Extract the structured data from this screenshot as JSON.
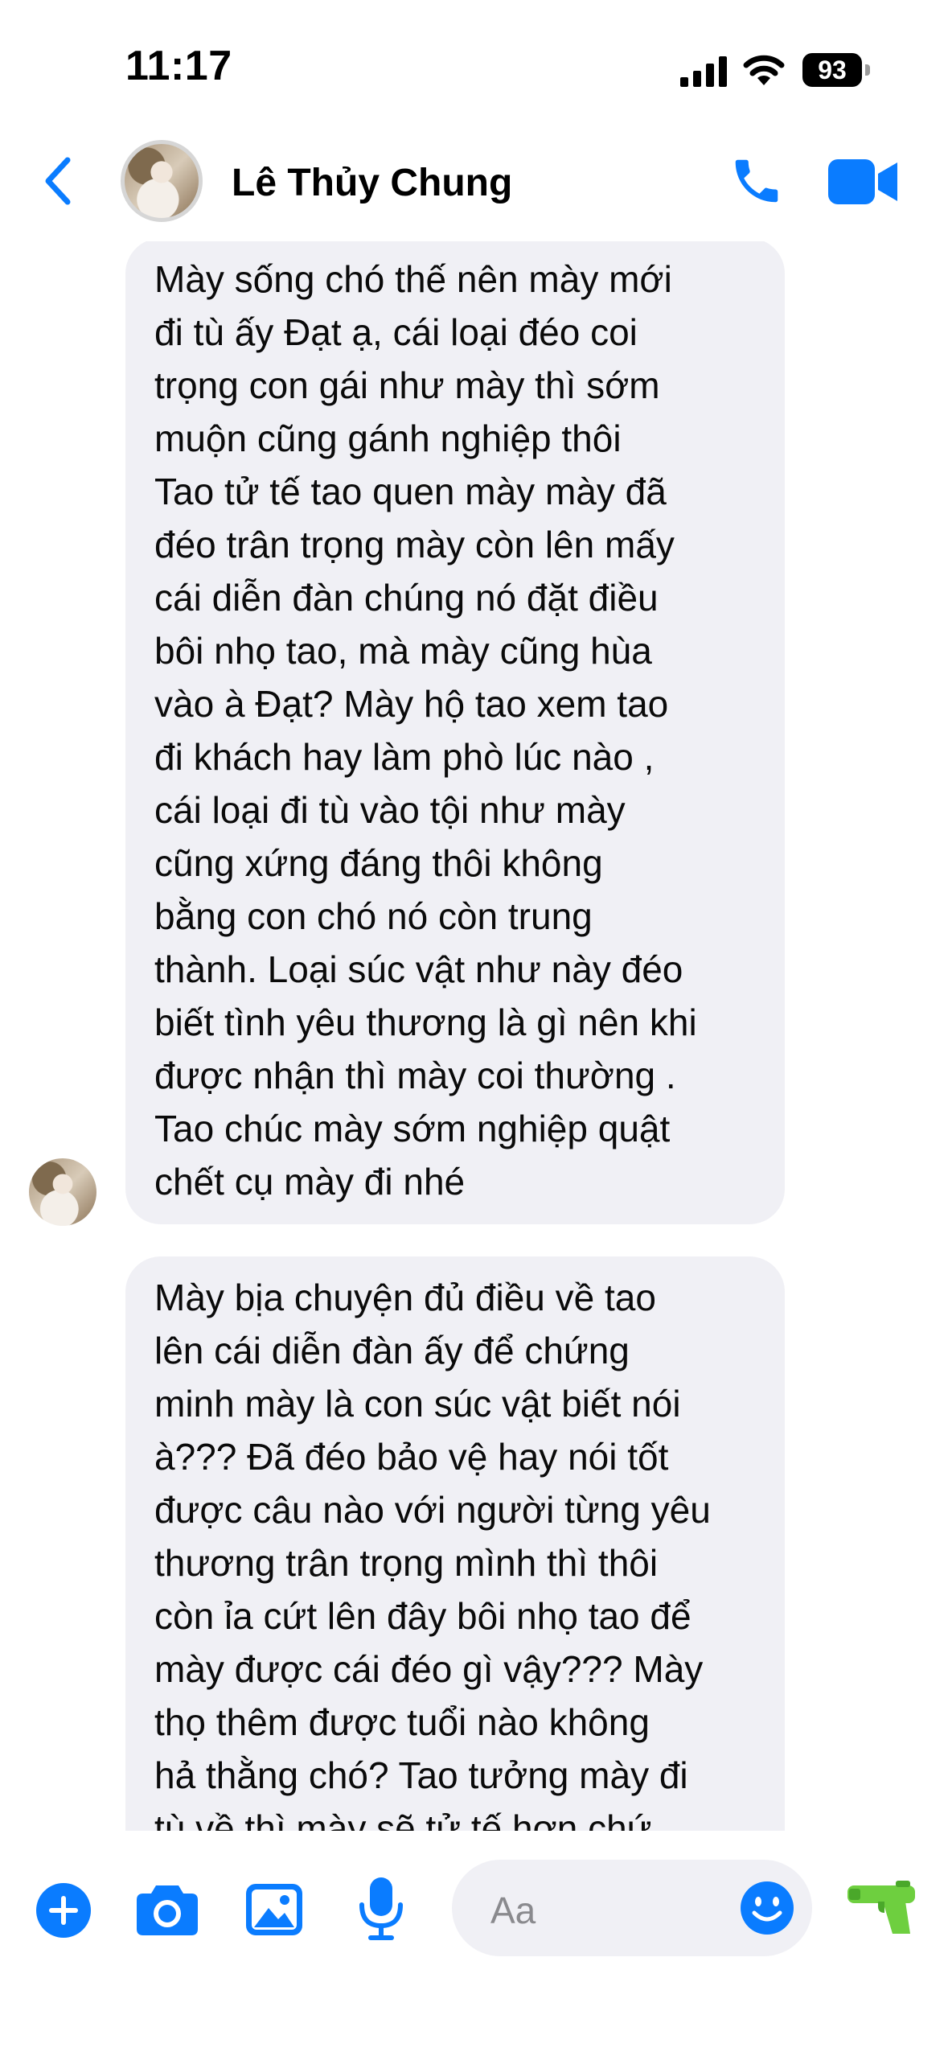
{
  "status_bar": {
    "time": "11:17",
    "battery": "93"
  },
  "header": {
    "contact_name": "Lê Thủy Chung"
  },
  "messages": [
    {
      "sender": "Lê Thủy Chung",
      "text": "Mày sống chó thế nên mày mới\nđi tù ấy Đạt ạ, cái loại đéo coi\ntrọng con gái như mày thì sớm\nmuộn cũng gánh nghiệp thôi\nTao tử tế tao quen mày mày đã\nđéo trân trọng mày còn lên mấy\ncái diễn đàn chúng nó đặt điều\nbôi nhọ tao, mà mày cũng hùa\nvào à Đạt? Mày hộ tao xem tao\nđi khách hay làm phò lúc nào ,\ncái loại đi tù vào tội như mày\ncũng xứng đáng thôi không\nbằng con chó nó còn trung\nthành. Loại súc vật như này đéo\nbiết tình yêu thương là gì nên khi\nđược nhận thì mày coi thường .\nTao chúc mày sớm nghiệp quật\nchết cụ mày đi nhé"
    },
    {
      "sender": "Lê Thủy Chung",
      "text": "Mày bịa chuyện đủ điều về tao\nlên cái diễn đàn  ấy để chứng\nminh mày là con súc vật biết nói\nà??? Đã đéo bảo vệ hay nói tốt\nđược câu nào với người từng yêu\nthương trân trọng mình thì thôi\ncòn ỉa cứt lên đây bôi nhọ tao để\nmày được cái đéo gì vậy??? Mày\nthọ thêm được tuổi nào không\nhả thằng chó? Tao tưởng mày đi\ntù về thì mày sẽ tử tế hơn chứ"
    }
  ],
  "composer": {
    "placeholder": "Aa"
  },
  "icons": {
    "back": "chevron-left-icon",
    "call": "phone-icon",
    "video": "video-camera-icon",
    "add": "plus-circle-icon",
    "camera": "camera-icon",
    "gallery": "photo-icon",
    "mic": "microphone-icon",
    "emoji": "smiley-icon",
    "quick_reaction": "water-gun-icon"
  },
  "colors": {
    "accent": "#0a7cff",
    "bubble_bg": "#f0f0f5",
    "quick_reaction": "#6ecf3f"
  }
}
